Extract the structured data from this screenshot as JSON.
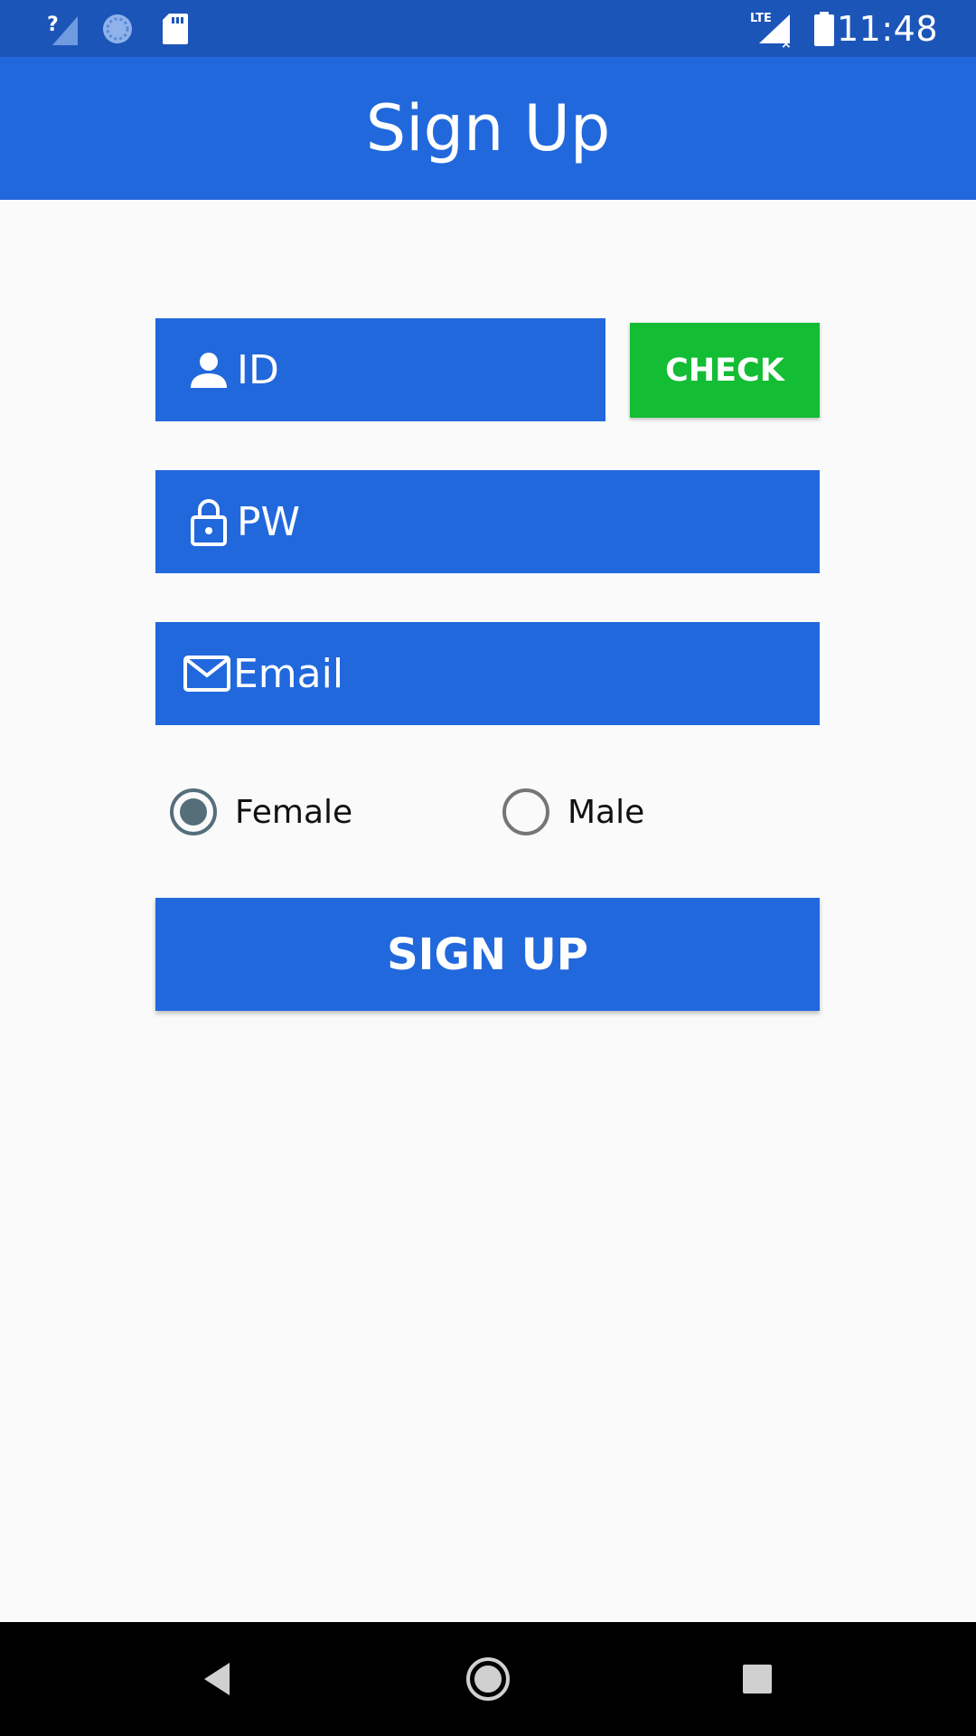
{
  "status_bar": {
    "time": "11:48",
    "icons": [
      "signal-unknown-icon",
      "sync-icon",
      "sd-card-icon",
      "lte-no-signal-icon",
      "battery-icon"
    ]
  },
  "app_bar": {
    "title": "Sign Up"
  },
  "form": {
    "id_field": {
      "placeholder": "ID",
      "icon": "person-icon"
    },
    "check_button": {
      "label": "CHECK"
    },
    "pw_field": {
      "placeholder": "PW",
      "icon": "lock-icon"
    },
    "email_field": {
      "placeholder": "Email",
      "icon": "mail-icon"
    },
    "gender": {
      "options": [
        "Female",
        "Male"
      ],
      "selected": "Female"
    },
    "signup_button": {
      "label": "SIGN UP"
    }
  },
  "nav_bar": {
    "buttons": [
      "back-icon",
      "home-icon",
      "recents-icon"
    ]
  },
  "colors": {
    "status_bar": "#1c55b8",
    "primary": "#2168dc",
    "check_green": "#13bd34",
    "background": "#fafafa",
    "radio_selected": "#546e7a"
  }
}
